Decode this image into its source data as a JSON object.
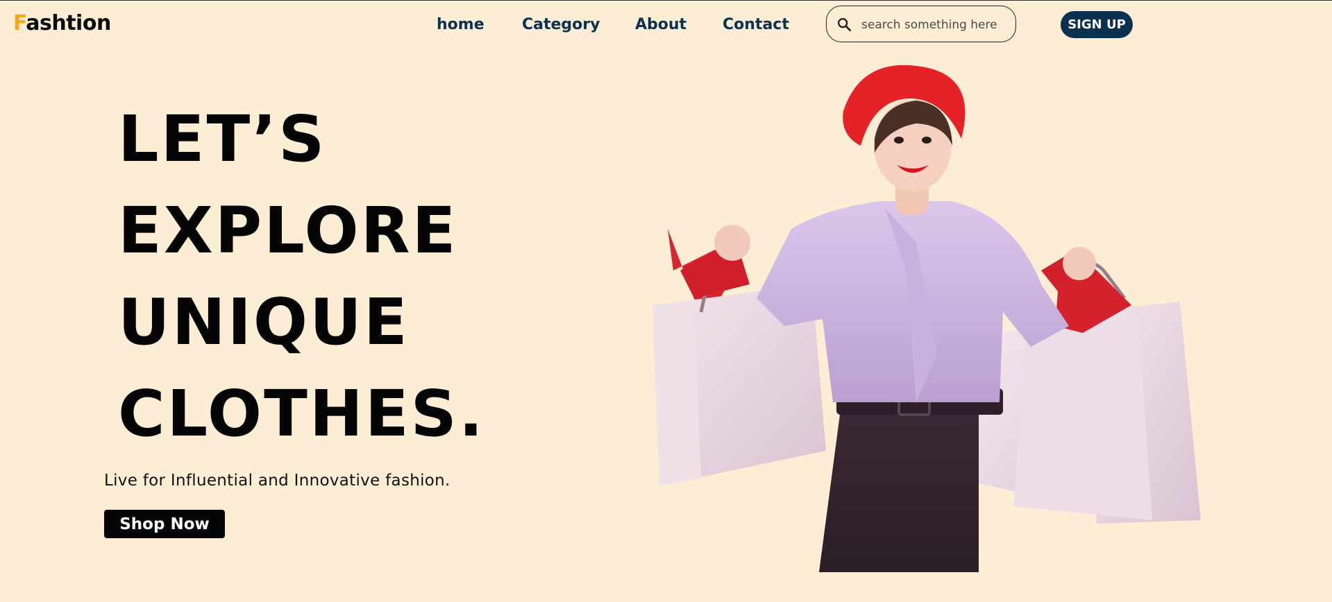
{
  "brand": {
    "first_letter": "F",
    "rest": "ashtion",
    "accent_color": "#f4a522"
  },
  "nav": {
    "links": [
      {
        "label": "home"
      },
      {
        "label": "Category"
      },
      {
        "label": "About"
      },
      {
        "label": "Contact"
      }
    ],
    "color": "#0c3050"
  },
  "search": {
    "placeholder": "search something here",
    "value": "",
    "icon": "search-icon"
  },
  "signup": {
    "label": "SIGN UP"
  },
  "hero": {
    "title_lines": [
      "LET’S",
      "EXPLORE",
      "UNIQUE",
      "CLOTHES."
    ],
    "tagline": "Live for Influential and Innovative fashion.",
    "cta": "Shop Now",
    "image": "woman-with-shopping-bags"
  },
  "colors": {
    "background": "#fcedd5",
    "primary": "#0c3050"
  }
}
